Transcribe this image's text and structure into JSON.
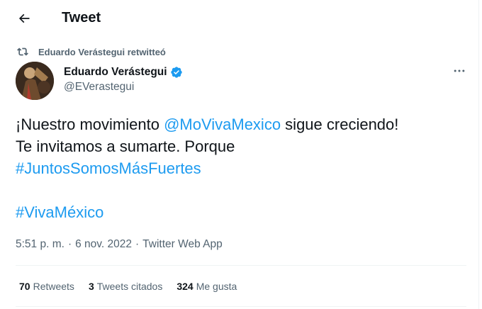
{
  "header": {
    "back_icon": "arrow-left-icon",
    "title": "Tweet"
  },
  "retweet": {
    "icon": "retweet-icon",
    "label": "Eduardo Verástegui retwitteó"
  },
  "author": {
    "display_name": "Eduardo Verástegui",
    "verified_icon": "verified-badge-icon",
    "handle": "@EVerastegui"
  },
  "more_icon": "more-horizontal-icon",
  "tweet": {
    "text_1": "¡Nuestro movimiento ",
    "mention": "@MoVivaMexico",
    "text_2": " sigue creciendo!",
    "line_2": "Te invitamos a sumarte. Porque",
    "hashtag_1": "#JuntosSomosMásFuertes",
    "hashtag_2": "#VivaMéxico"
  },
  "meta": {
    "time": "5:51 p. m.",
    "separator_1": "·",
    "date": "6 nov. 2022",
    "separator_2": "·",
    "source": "Twitter Web App"
  },
  "stats": {
    "retweets_count": "70",
    "retweets_label": "Retweets",
    "quotes_count": "3",
    "quotes_label": "Tweets citados",
    "likes_count": "324",
    "likes_label": "Me gusta"
  },
  "colors": {
    "link": "#1d9bf0",
    "secondary_text": "#536471",
    "primary_text": "#0f1419",
    "divider": "#eff3f4"
  }
}
